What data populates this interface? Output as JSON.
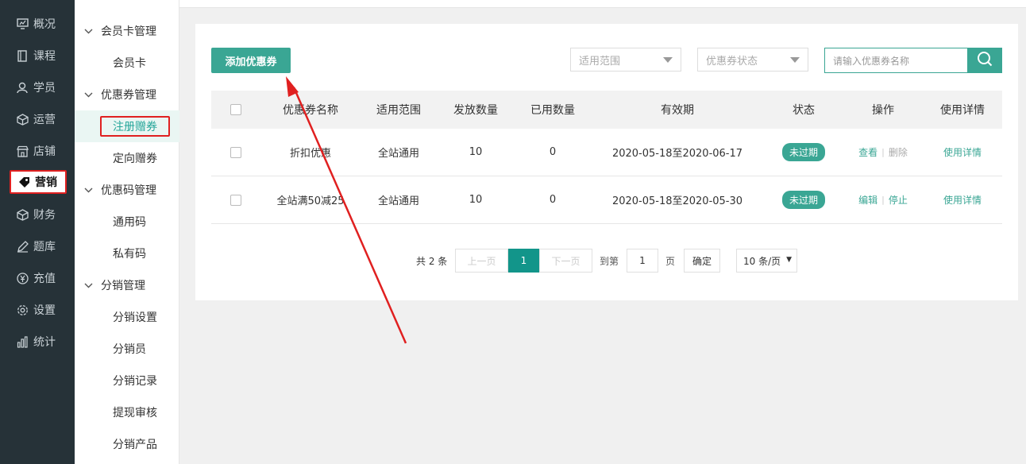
{
  "sidebar": {
    "items": [
      {
        "label": "概况",
        "icon": "monitor-icon"
      },
      {
        "label": "课程",
        "icon": "book-icon"
      },
      {
        "label": "学员",
        "icon": "user-icon"
      },
      {
        "label": "运营",
        "icon": "cube-icon"
      },
      {
        "label": "店铺",
        "icon": "shop-icon"
      },
      {
        "label": "营销",
        "icon": "tag-icon"
      },
      {
        "label": "财务",
        "icon": "cube-icon"
      },
      {
        "label": "题库",
        "icon": "pen-icon"
      },
      {
        "label": "充值",
        "icon": "yen-icon"
      },
      {
        "label": "设置",
        "icon": "gear-icon"
      },
      {
        "label": "统计",
        "icon": "bar-chart-icon"
      }
    ],
    "active_index": 5
  },
  "submenu": {
    "groups": [
      {
        "label": "会员卡管理",
        "items": [
          "会员卡"
        ]
      },
      {
        "label": "优惠券管理",
        "items": [
          "注册赠券",
          "定向赠券"
        ]
      },
      {
        "label": "优惠码管理",
        "items": [
          "通用码",
          "私有码"
        ]
      },
      {
        "label": "分销管理",
        "items": [
          "分销设置",
          "分销员",
          "分销记录",
          "提现审核",
          "分销产品"
        ]
      }
    ],
    "selected": "注册赠券"
  },
  "toolbar": {
    "add_label": "添加优惠券",
    "scope_placeholder": "适用范围",
    "status_placeholder": "优惠券状态",
    "search_placeholder": "请输入优惠券名称"
  },
  "table": {
    "headers": [
      "优惠券名称",
      "适用范围",
      "发放数量",
      "已用数量",
      "有效期",
      "状态",
      "操作",
      "使用详情"
    ],
    "rows": [
      {
        "name": "折扣优惠",
        "scope": "全站通用",
        "issued": "10",
        "used": "0",
        "validity": "2020-05-18至2020-06-17",
        "status": "未过期",
        "op1": "查看",
        "op2": "删除",
        "op2_disabled": true,
        "detail": "使用详情"
      },
      {
        "name": "全站满50减25",
        "scope": "全站通用",
        "issued": "10",
        "used": "0",
        "validity": "2020-05-18至2020-05-30",
        "status": "未过期",
        "op1": "编辑",
        "op2": "停止",
        "op2_disabled": false,
        "detail": "使用详情"
      }
    ]
  },
  "pager": {
    "total": "共 2 条",
    "prev": "上一页",
    "current": "1",
    "next": "下一页",
    "goto_prefix": "到第",
    "goto_value": "1",
    "goto_suffix": "页",
    "confirm": "确定",
    "page_size": "10 条/页"
  },
  "colors": {
    "accent": "#3aa694",
    "sidebar_bg": "#263238",
    "highlight_red": "#e02020"
  }
}
